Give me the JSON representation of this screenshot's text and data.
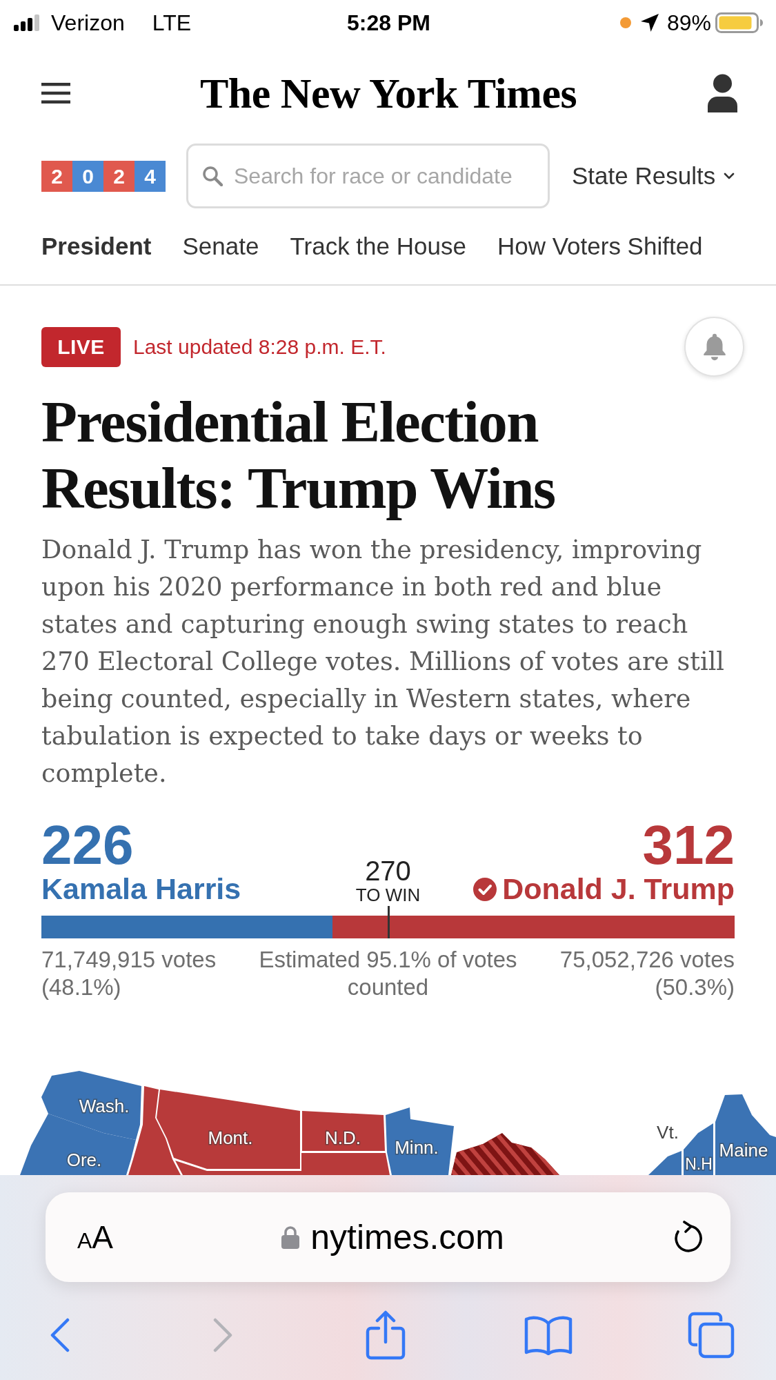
{
  "status_bar": {
    "carrier": "Verizon",
    "network": "LTE",
    "time": "5:28 PM",
    "battery": "89%"
  },
  "header": {
    "logo": "The New York Times"
  },
  "election_nav": {
    "year_badge": [
      {
        "digit": "2",
        "color": "#e0594e"
      },
      {
        "digit": "0",
        "color": "#4a89d3"
      },
      {
        "digit": "2",
        "color": "#e0594e"
      },
      {
        "digit": "4",
        "color": "#4a89d3"
      }
    ],
    "search": {
      "placeholder": "Search for race or candidate"
    },
    "state_menu": "State Results"
  },
  "tabs": [
    {
      "label": "President",
      "selected": true
    },
    {
      "label": "Senate",
      "selected": false
    },
    {
      "label": "Track the House",
      "selected": false
    },
    {
      "label": "How Voters Shifted",
      "selected": false
    }
  ],
  "live": {
    "badge": "LIVE",
    "updated": "Last updated 8:28 p.m. E.T."
  },
  "headline": "Presidential Election Results: Trump Wins",
  "summary": "Donald J. Trump has won the presidency, improving upon his 2020 performance in both red and blue states and capturing enough swing states to reach 270 Electoral College votes. Millions of votes are still being counted, especially in Western states, where tabulation is expected to take days or weeks to complete.",
  "results": {
    "candidates": [
      {
        "electoral_votes": "226",
        "name": "Kamala Harris",
        "winner": false,
        "color": "#3571b0",
        "popular_votes": "71,749,915 votes (48.1%)"
      },
      {
        "electoral_votes": "312",
        "name": "Donald J. Trump",
        "winner": true,
        "color": "#b8383a",
        "popular_votes": "75,052,726 votes (50.3%)"
      }
    ],
    "threshold": {
      "number": "270",
      "label": "TO WIN"
    },
    "bar": {
      "level": 0.42
    },
    "counted": "Estimated 95.1% of votes counted"
  },
  "map": {
    "states": [
      {
        "label": "Wash.",
        "color": "#3b73b4",
        "striped": false
      },
      {
        "label": "Ore.",
        "color": "#3b73b4",
        "striped": false
      },
      {
        "color": "#b83a3a",
        "striped": false
      },
      {
        "label": "Mont.",
        "color": "#b83a3a",
        "striped": false
      },
      {
        "label": "N.D.",
        "color": "#b83a3a",
        "striped": false
      },
      {
        "color": "#b83a3a",
        "striped": false
      },
      {
        "label": "Minn.",
        "color": "#3b73b4",
        "striped": false
      },
      {
        "color": "#7e1414",
        "striped": true
      },
      {
        "label": "Vt.",
        "color": "#3b73b4",
        "striped": false
      },
      {
        "label": "N.H",
        "color": "#3b73b4",
        "striped": false
      },
      {
        "label": "Maine",
        "color": "#3b73b4",
        "striped": false
      }
    ]
  },
  "browser": {
    "text_size": {
      "small": "A",
      "large": "A"
    },
    "url": "nytimes.com",
    "toolbar": [
      {
        "kind": "back",
        "disabled": false
      },
      {
        "kind": "forward",
        "disabled": true
      },
      {
        "kind": "share",
        "disabled": false
      },
      {
        "kind": "bookmarks",
        "disabled": false
      },
      {
        "kind": "tabs",
        "disabled": false
      }
    ]
  }
}
